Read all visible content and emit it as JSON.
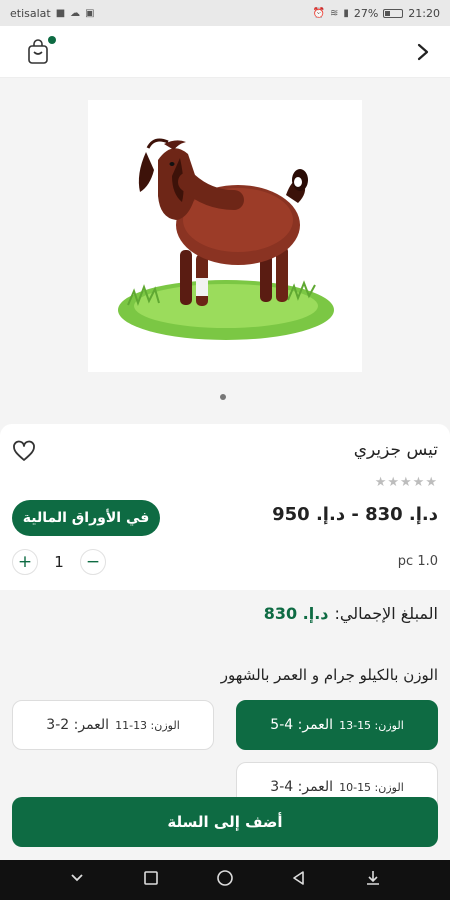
{
  "status_bar": {
    "carrier": "etisalat",
    "battery": "27%",
    "time": "21:20"
  },
  "product": {
    "name": "تيس جزيري",
    "price_range": "د.إ. 830 - د.إ. 950",
    "rating_stars": "★★★★★",
    "installment_label": "في الأوراق المالية",
    "quantity": "1",
    "unit": "pc 1.0",
    "qty_plus": "+",
    "qty_minus": "−"
  },
  "total": {
    "label": "المبلغ الإجمالي:",
    "amount": "د.إ. 830"
  },
  "options": {
    "title": "الوزن بالكيلو جرام و العمر بالشهور",
    "items": [
      {
        "weight_label": "الوزن: 15-13",
        "age_label": "العمر: 4-5",
        "selected": true
      },
      {
        "weight_label": "الوزن: 13-11",
        "age_label": "العمر: 2-3",
        "selected": false
      },
      {
        "weight_label": "الوزن: 15-10",
        "age_label": "العمر: 4-3",
        "selected": false
      }
    ]
  },
  "actions": {
    "add_to_cart": "أضف إلى السلة"
  },
  "icons": {
    "cart": "shopping-bag-icon",
    "forward": "chevron-right-icon",
    "favorite": "heart-icon"
  },
  "colors": {
    "accent": "#0e6b43"
  }
}
